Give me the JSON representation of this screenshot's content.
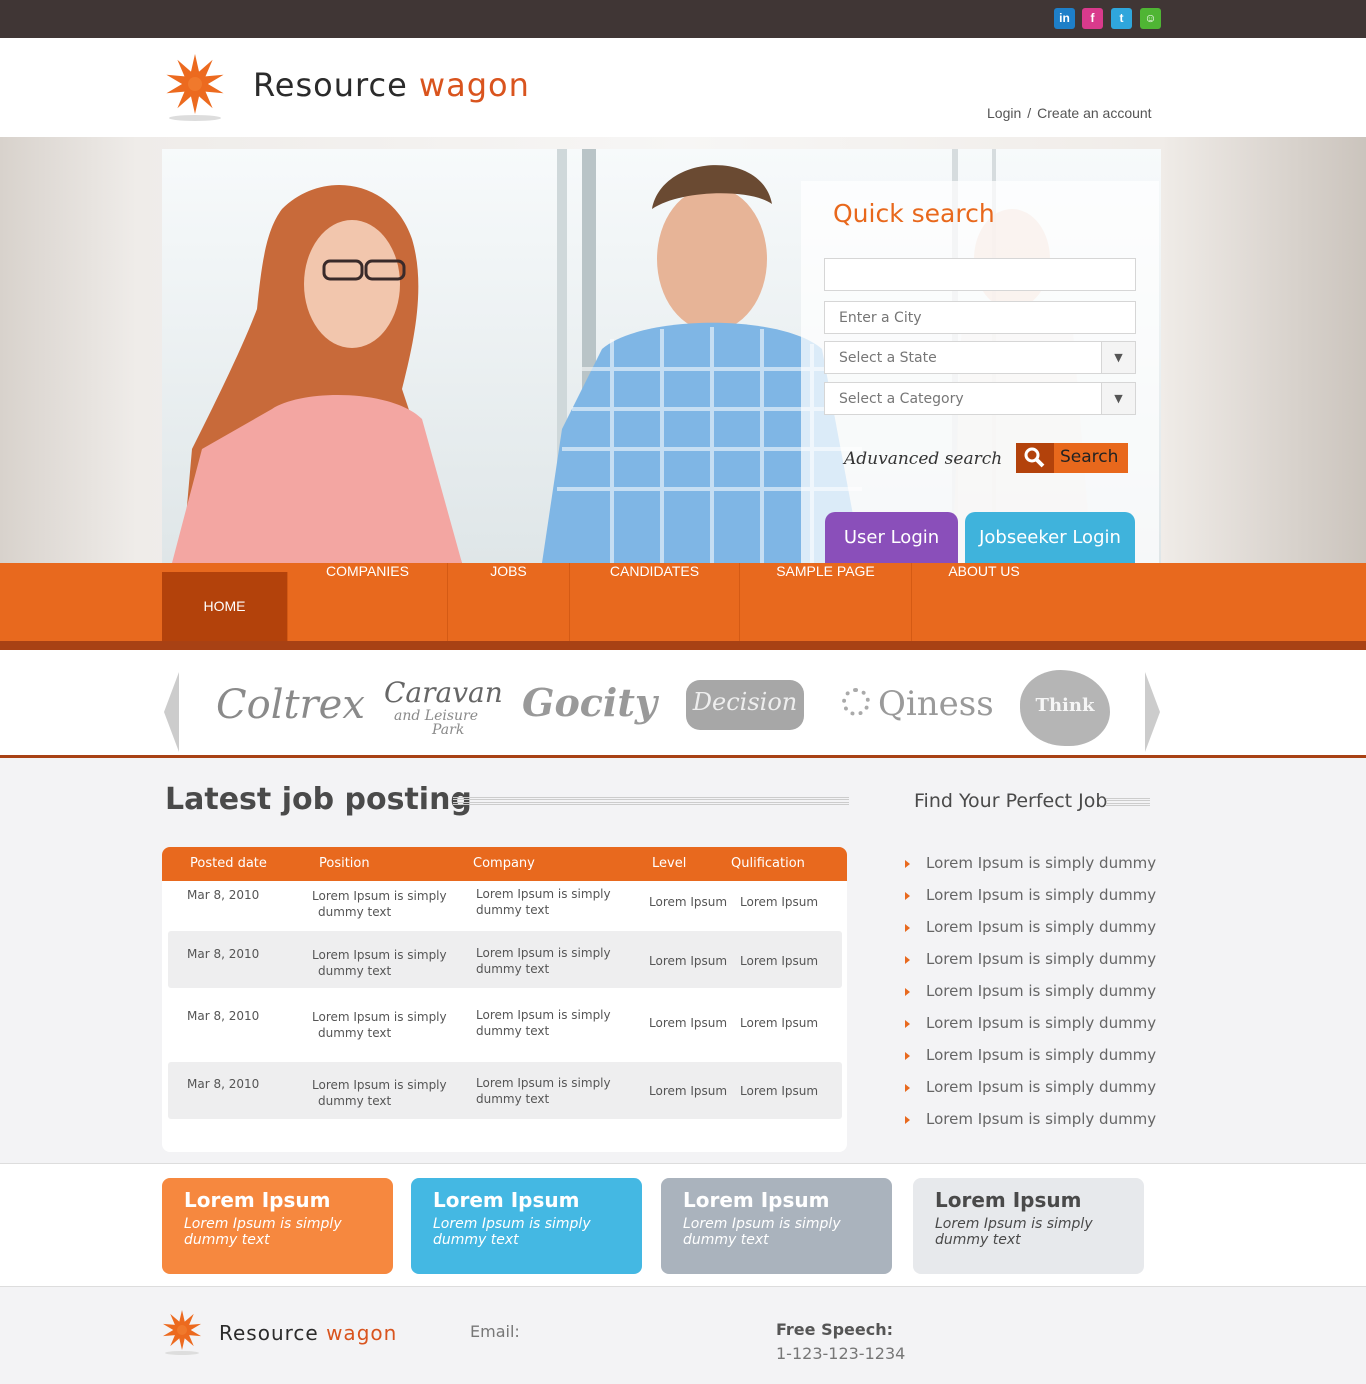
{
  "social": [
    {
      "icon": "linkedin-icon",
      "glyph": "in",
      "color": "#1e7fc8"
    },
    {
      "icon": "facebook-icon",
      "glyph": "f",
      "color": "#d93a8c"
    },
    {
      "icon": "twitter-icon",
      "glyph": "t",
      "color": "#2fa6dc"
    },
    {
      "icon": "chat-icon",
      "glyph": "☺",
      "color": "#4fb534"
    }
  ],
  "brand": {
    "part1": "Resource",
    "part2": "wagon"
  },
  "auth": {
    "login": "Login",
    "separator": "/",
    "create": "Create an account"
  },
  "quick_search": {
    "title": "Quick search",
    "keyword_placeholder": "",
    "city_placeholder": "Enter a City",
    "state_label": "Select a State",
    "category_label": "Select a Category",
    "advanced": "Aduvanced search",
    "search_button": "Search",
    "user_login": "User Login",
    "jobseeker_login": "Jobseeker Login"
  },
  "nav": [
    "HOME",
    "COMPANIES",
    "JOBS",
    "CANDIDATES",
    "SAMPLE PAGE",
    "ABOUT US"
  ],
  "logos": {
    "coltrex": "Coltrex",
    "caravan": "Caravan",
    "caravan_sub1": "and Leisure",
    "caravan_sub2": "Park",
    "gocity": "Gocity",
    "decision": "Decision",
    "qiness": "Qiness",
    "think": "Think"
  },
  "jobs": {
    "title": "Latest job posting",
    "headers": [
      "Posted date",
      "Position",
      "Company",
      "Level",
      "Qulification"
    ],
    "rows": [
      {
        "date": "Mar 8, 2010",
        "position_1": "Lorem Ipsum is simply",
        "position_2": "dummy text",
        "company_1": "Lorem Ipsum is simply",
        "company_2": "dummy text",
        "level": "Lorem Ipsum",
        "qual": "Lorem Ipsum"
      },
      {
        "date": "Mar 8, 2010",
        "position_1": "Lorem Ipsum is simply",
        "position_2": "dummy text",
        "company_1": "Lorem Ipsum is simply",
        "company_2": "dummy text",
        "level": "Lorem Ipsum",
        "qual": "Lorem Ipsum"
      },
      {
        "date": "Mar 8, 2010",
        "position_1": "Lorem Ipsum is simply",
        "position_2": "dummy text",
        "company_1": "Lorem Ipsum is simply",
        "company_2": "dummy text",
        "level": "Lorem Ipsum",
        "qual": "Lorem Ipsum"
      },
      {
        "date": "Mar 8, 2010",
        "position_1": "Lorem Ipsum is simply",
        "position_2": "dummy text",
        "company_1": "Lorem Ipsum is simply",
        "company_2": "dummy text",
        "level": "Lorem Ipsum",
        "qual": "Lorem Ipsum"
      }
    ]
  },
  "find_job": {
    "title": "Find Your Perfect Job",
    "items": [
      "Lorem Ipsum is simply dummy",
      "Lorem Ipsum is simply dummy",
      "Lorem Ipsum is simply dummy",
      "Lorem Ipsum is simply dummy",
      "Lorem Ipsum is simply dummy",
      "Lorem Ipsum is simply dummy",
      "Lorem Ipsum is simply dummy",
      "Lorem Ipsum is simply dummy",
      "Lorem Ipsum is simply dummy"
    ]
  },
  "cards": [
    {
      "title": "Lorem Ipsum",
      "text": "Lorem Ipsum is simply dummy text",
      "bg": "#f6883f",
      "fg": "#ffffff"
    },
    {
      "title": "Lorem Ipsum",
      "text": "Lorem Ipsum is simply dummy text",
      "bg": "#44b8e3",
      "fg": "#ffffff"
    },
    {
      "title": "Lorem Ipsum",
      "text": "Lorem Ipsum is simply dummy text",
      "bg": "#aab3bd",
      "fg": "#ffffff"
    },
    {
      "title": "Lorem Ipsum",
      "text": "Lorem Ipsum is simply dummy text",
      "bg": "#e7e9ec",
      "fg": "#4a4a4a"
    }
  ],
  "footer": {
    "email_label": "Email:",
    "speech_label": "Free Speech:",
    "phone": "1-123-123-1234"
  },
  "colors": {
    "accent": "#e8691e",
    "accent_dark": "#b3420b",
    "purple": "#8a4fba",
    "blue": "#3fb3dc"
  }
}
